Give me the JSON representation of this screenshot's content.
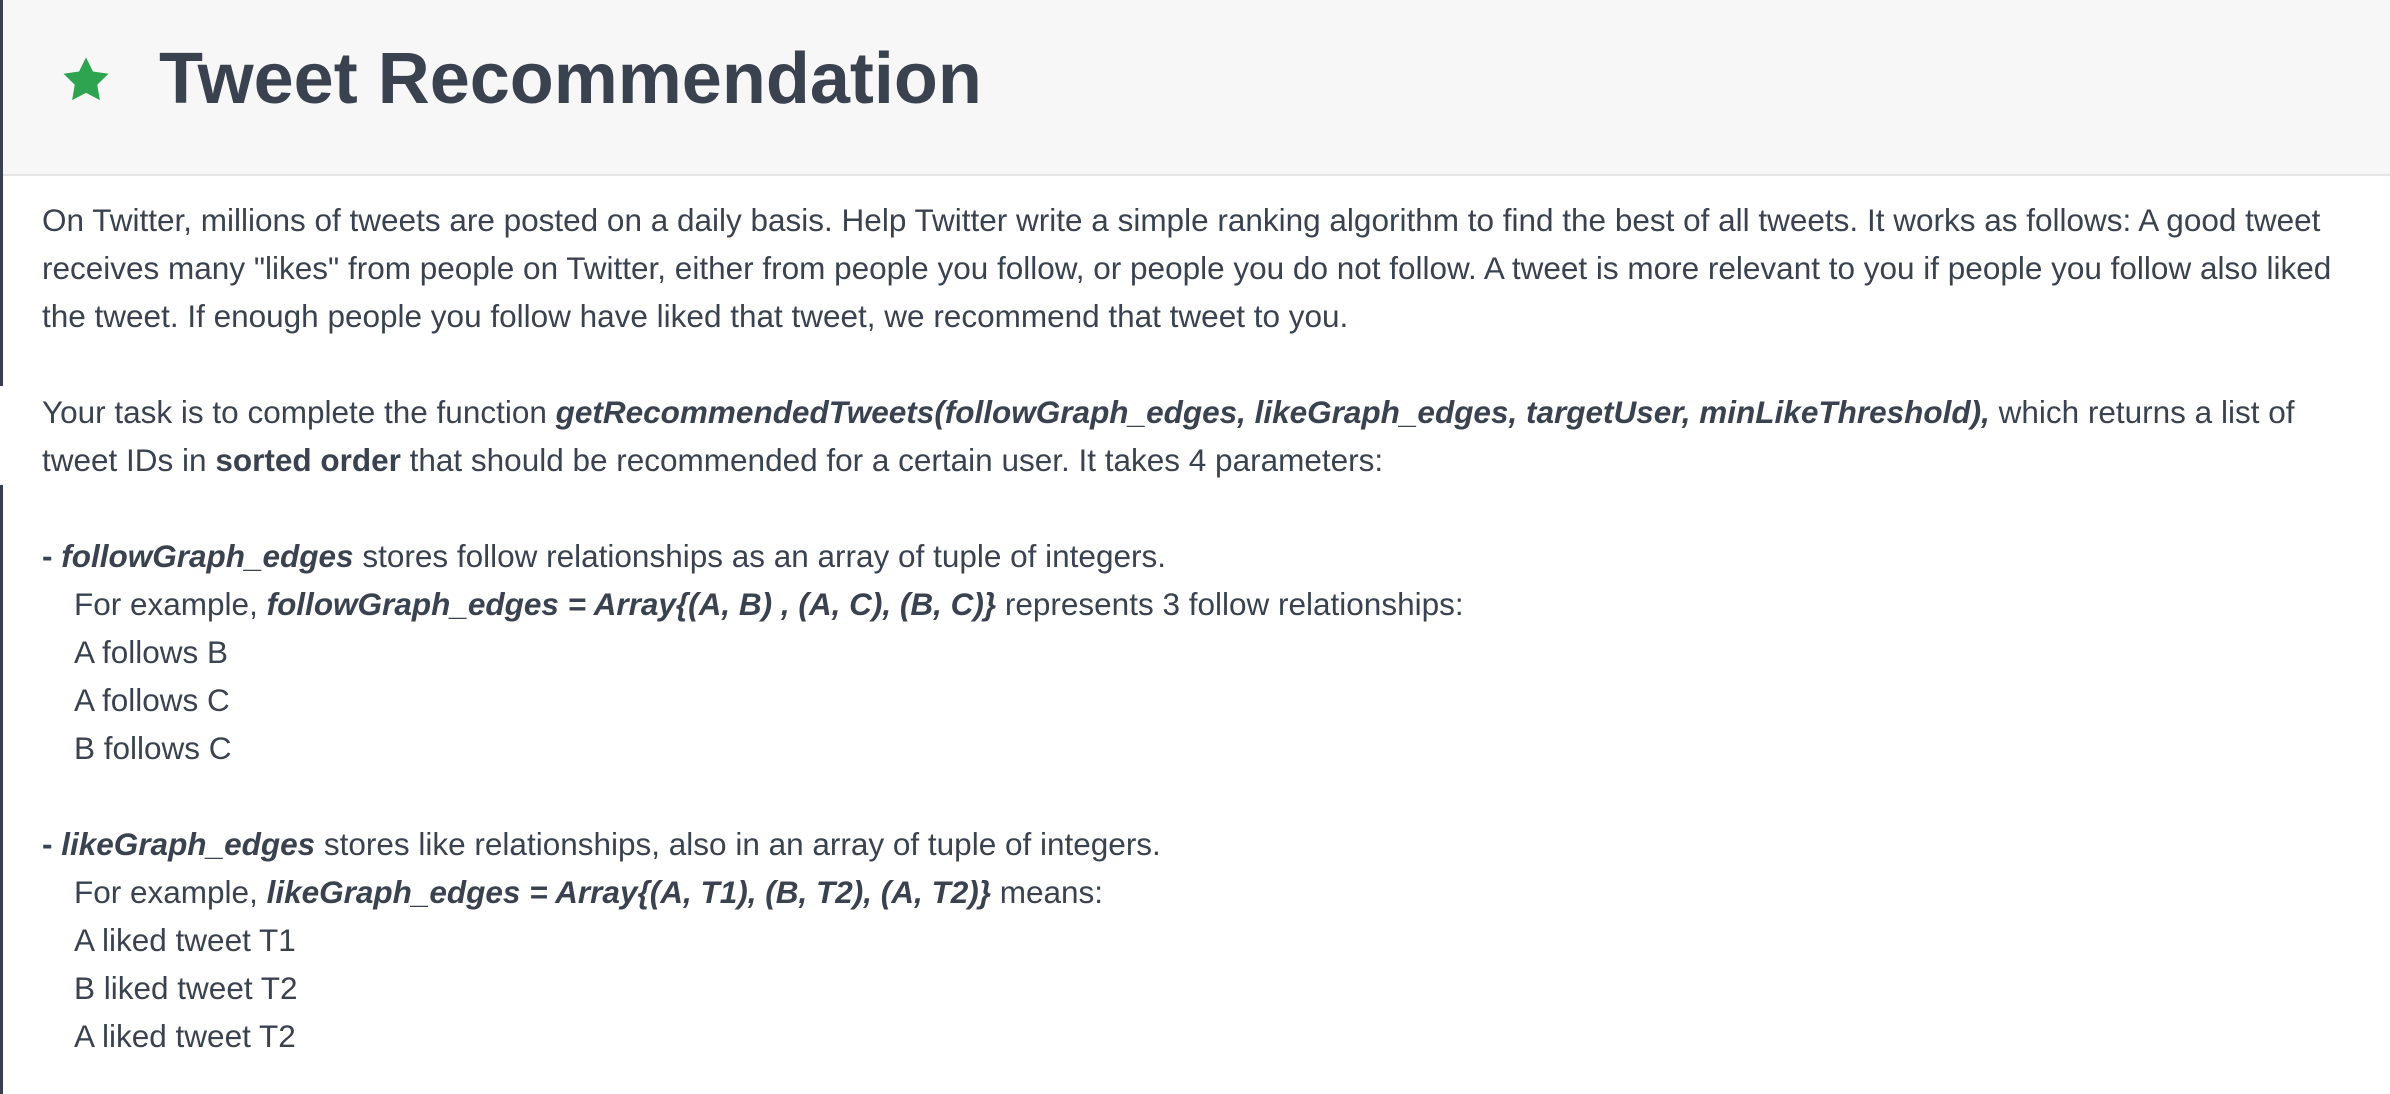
{
  "header": {
    "title": "Tweet Recommendation",
    "icon": "star-icon",
    "icon_color": "#2ea350"
  },
  "intro": {
    "text": "On Twitter, millions of tweets are posted on a daily basis. Help Twitter write a simple ranking algorithm to find the best of all tweets. It works as follows: A good tweet receives many \"likes\" from people on Twitter, either from people you follow, or people you do not follow. A tweet is more relevant to you if people you follow also liked the tweet. If enough people you follow have liked that tweet, we recommend that tweet to you."
  },
  "task": {
    "prefix": "Your task is to complete the function ",
    "function_signature": "getRecommendedTweets(followGraph_edges, likeGraph_edges, targetUser, minLikeThreshold),",
    "middle": " which returns a list of tweet IDs in ",
    "sorted_order": "sorted order",
    "suffix": " that should be recommended for a certain user. It takes 4 parameters:"
  },
  "follow_param": {
    "dash": "- ",
    "name": "followGraph_edges",
    "description": " stores follow relationships as an array of tuple of integers.",
    "example_prefix": "For example, ",
    "example_code": "followGraph_edges = Array{(A, B) , (A, C), (B, C)}",
    "example_suffix": " represents 3 follow relationships:",
    "lines": [
      "A follows B",
      "A follows C",
      "B follows C"
    ]
  },
  "like_param": {
    "dash": "- ",
    "name": "likeGraph_edges",
    "description": " stores like relationships, also in an array of tuple of integers.",
    "example_prefix": "For example, ",
    "example_code": "likeGraph_edges = Array{(A, T1), (B, T2), (A, T2)}",
    "example_suffix": " means:",
    "lines": [
      "A liked tweet T1",
      "B liked tweet T2",
      "A liked tweet T2"
    ]
  }
}
